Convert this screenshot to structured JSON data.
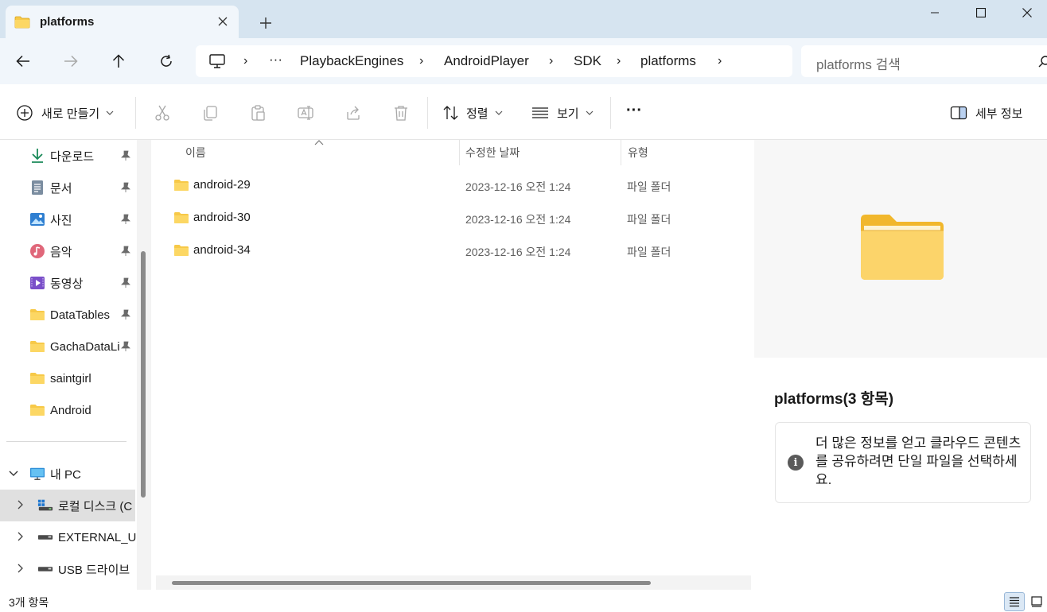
{
  "window": {
    "tab_title": "platforms",
    "tab_icon": "folder-icon",
    "new_tab_icon": "plus-icon",
    "controls": [
      "minimize-icon",
      "maximize-icon",
      "close-icon"
    ]
  },
  "address": {
    "nav_buttons": [
      "back-arrow-icon",
      "forward-arrow-icon",
      "up-arrow-icon",
      "refresh-icon"
    ],
    "breadcrumb": {
      "root_icon": "this-pc-icon",
      "overflow": "···",
      "items": [
        "PlaybackEngines",
        "AndroidPlayer",
        "SDK",
        "platforms"
      ],
      "separator": "›"
    },
    "search_placeholder": "platforms 검색"
  },
  "commandbar": {
    "new_label": "새로 만들기",
    "sort_label": "정렬",
    "view_label": "보기",
    "more_label": "···",
    "details_label": "세부 정보",
    "disabled_actions": [
      "cut-icon",
      "copy-icon",
      "paste-icon",
      "rename-icon",
      "share-icon",
      "delete-icon"
    ]
  },
  "sidebar": {
    "quick_access": [
      {
        "label": "다운로드",
        "icon": "download-icon",
        "pinned": true
      },
      {
        "label": "문서",
        "icon": "document-icon",
        "pinned": true
      },
      {
        "label": "사진",
        "icon": "pictures-icon",
        "pinned": true
      },
      {
        "label": "음악",
        "icon": "music-icon",
        "pinned": true
      },
      {
        "label": "동영상",
        "icon": "videos-icon",
        "pinned": true
      },
      {
        "label": "DataTables",
        "icon": "folder-icon",
        "pinned": true
      },
      {
        "label": "GachaDataLi",
        "icon": "folder-icon",
        "pinned": true
      },
      {
        "label": "saintgirl",
        "icon": "folder-icon",
        "pinned": false
      },
      {
        "label": "Android",
        "icon": "folder-icon",
        "pinned": false
      }
    ],
    "this_pc": {
      "label": "내 PC",
      "icon": "computer-icon",
      "expanded": true
    },
    "drives": [
      {
        "label": "로컬 디스크 (C",
        "icon": "windows-drive-icon",
        "selected": true
      },
      {
        "label": "EXTERNAL_US",
        "icon": "drive-icon",
        "selected": false
      },
      {
        "label": "USB 드라이브",
        "icon": "drive-icon",
        "selected": false
      }
    ]
  },
  "file_list": {
    "columns": [
      "이름",
      "수정한 날짜",
      "유형"
    ],
    "rows": [
      {
        "name": "android-29",
        "modified": "2023-12-16 오전 1:24",
        "type": "파일 폴더"
      },
      {
        "name": "android-30",
        "modified": "2023-12-16 오전 1:24",
        "type": "파일 폴더"
      },
      {
        "name": "android-34",
        "modified": "2023-12-16 오전 1:24",
        "type": "파일 폴더"
      }
    ]
  },
  "details": {
    "title": "platforms(3 항목)",
    "info": "더 많은 정보를 얻고 클라우드 콘텐츠를 공유하려면 단일 파일을 선택하세요."
  },
  "status": {
    "item_count": "3개 항목",
    "active_view": "details"
  },
  "colors": {
    "titlebar_bg": "#d6e4f0",
    "toolbar_bg": "#f1f6fb",
    "folder_yellow": "#f7c948",
    "selected_bg": "#e0e0e0"
  }
}
